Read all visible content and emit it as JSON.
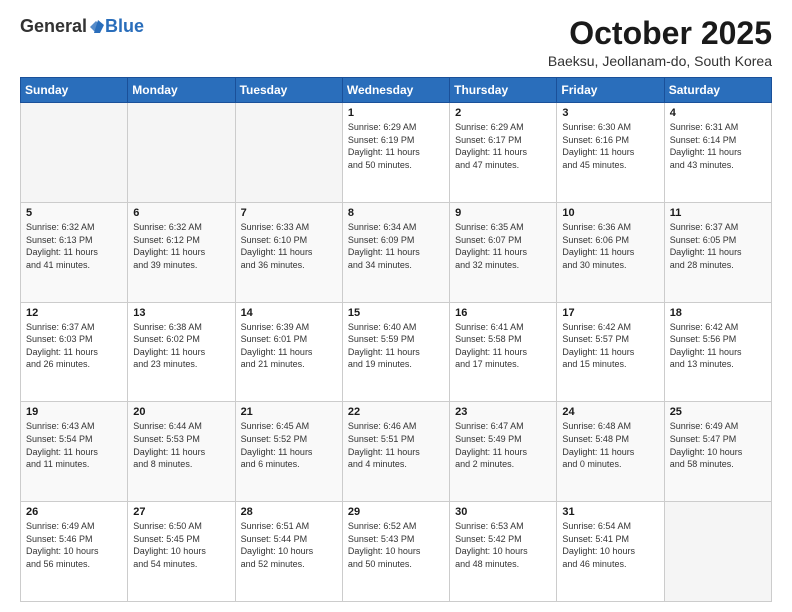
{
  "logo": {
    "general": "General",
    "blue": "Blue"
  },
  "header": {
    "month": "October 2025",
    "location": "Baeksu, Jeollanam-do, South Korea"
  },
  "days_of_week": [
    "Sunday",
    "Monday",
    "Tuesday",
    "Wednesday",
    "Thursday",
    "Friday",
    "Saturday"
  ],
  "weeks": [
    [
      {
        "day": "",
        "info": ""
      },
      {
        "day": "",
        "info": ""
      },
      {
        "day": "",
        "info": ""
      },
      {
        "day": "1",
        "info": "Sunrise: 6:29 AM\nSunset: 6:19 PM\nDaylight: 11 hours\nand 50 minutes."
      },
      {
        "day": "2",
        "info": "Sunrise: 6:29 AM\nSunset: 6:17 PM\nDaylight: 11 hours\nand 47 minutes."
      },
      {
        "day": "3",
        "info": "Sunrise: 6:30 AM\nSunset: 6:16 PM\nDaylight: 11 hours\nand 45 minutes."
      },
      {
        "day": "4",
        "info": "Sunrise: 6:31 AM\nSunset: 6:14 PM\nDaylight: 11 hours\nand 43 minutes."
      }
    ],
    [
      {
        "day": "5",
        "info": "Sunrise: 6:32 AM\nSunset: 6:13 PM\nDaylight: 11 hours\nand 41 minutes."
      },
      {
        "day": "6",
        "info": "Sunrise: 6:32 AM\nSunset: 6:12 PM\nDaylight: 11 hours\nand 39 minutes."
      },
      {
        "day": "7",
        "info": "Sunrise: 6:33 AM\nSunset: 6:10 PM\nDaylight: 11 hours\nand 36 minutes."
      },
      {
        "day": "8",
        "info": "Sunrise: 6:34 AM\nSunset: 6:09 PM\nDaylight: 11 hours\nand 34 minutes."
      },
      {
        "day": "9",
        "info": "Sunrise: 6:35 AM\nSunset: 6:07 PM\nDaylight: 11 hours\nand 32 minutes."
      },
      {
        "day": "10",
        "info": "Sunrise: 6:36 AM\nSunset: 6:06 PM\nDaylight: 11 hours\nand 30 minutes."
      },
      {
        "day": "11",
        "info": "Sunrise: 6:37 AM\nSunset: 6:05 PM\nDaylight: 11 hours\nand 28 minutes."
      }
    ],
    [
      {
        "day": "12",
        "info": "Sunrise: 6:37 AM\nSunset: 6:03 PM\nDaylight: 11 hours\nand 26 minutes."
      },
      {
        "day": "13",
        "info": "Sunrise: 6:38 AM\nSunset: 6:02 PM\nDaylight: 11 hours\nand 23 minutes."
      },
      {
        "day": "14",
        "info": "Sunrise: 6:39 AM\nSunset: 6:01 PM\nDaylight: 11 hours\nand 21 minutes."
      },
      {
        "day": "15",
        "info": "Sunrise: 6:40 AM\nSunset: 5:59 PM\nDaylight: 11 hours\nand 19 minutes."
      },
      {
        "day": "16",
        "info": "Sunrise: 6:41 AM\nSunset: 5:58 PM\nDaylight: 11 hours\nand 17 minutes."
      },
      {
        "day": "17",
        "info": "Sunrise: 6:42 AM\nSunset: 5:57 PM\nDaylight: 11 hours\nand 15 minutes."
      },
      {
        "day": "18",
        "info": "Sunrise: 6:42 AM\nSunset: 5:56 PM\nDaylight: 11 hours\nand 13 minutes."
      }
    ],
    [
      {
        "day": "19",
        "info": "Sunrise: 6:43 AM\nSunset: 5:54 PM\nDaylight: 11 hours\nand 11 minutes."
      },
      {
        "day": "20",
        "info": "Sunrise: 6:44 AM\nSunset: 5:53 PM\nDaylight: 11 hours\nand 8 minutes."
      },
      {
        "day": "21",
        "info": "Sunrise: 6:45 AM\nSunset: 5:52 PM\nDaylight: 11 hours\nand 6 minutes."
      },
      {
        "day": "22",
        "info": "Sunrise: 6:46 AM\nSunset: 5:51 PM\nDaylight: 11 hours\nand 4 minutes."
      },
      {
        "day": "23",
        "info": "Sunrise: 6:47 AM\nSunset: 5:49 PM\nDaylight: 11 hours\nand 2 minutes."
      },
      {
        "day": "24",
        "info": "Sunrise: 6:48 AM\nSunset: 5:48 PM\nDaylight: 11 hours\nand 0 minutes."
      },
      {
        "day": "25",
        "info": "Sunrise: 6:49 AM\nSunset: 5:47 PM\nDaylight: 10 hours\nand 58 minutes."
      }
    ],
    [
      {
        "day": "26",
        "info": "Sunrise: 6:49 AM\nSunset: 5:46 PM\nDaylight: 10 hours\nand 56 minutes."
      },
      {
        "day": "27",
        "info": "Sunrise: 6:50 AM\nSunset: 5:45 PM\nDaylight: 10 hours\nand 54 minutes."
      },
      {
        "day": "28",
        "info": "Sunrise: 6:51 AM\nSunset: 5:44 PM\nDaylight: 10 hours\nand 52 minutes."
      },
      {
        "day": "29",
        "info": "Sunrise: 6:52 AM\nSunset: 5:43 PM\nDaylight: 10 hours\nand 50 minutes."
      },
      {
        "day": "30",
        "info": "Sunrise: 6:53 AM\nSunset: 5:42 PM\nDaylight: 10 hours\nand 48 minutes."
      },
      {
        "day": "31",
        "info": "Sunrise: 6:54 AM\nSunset: 5:41 PM\nDaylight: 10 hours\nand 46 minutes."
      },
      {
        "day": "",
        "info": ""
      }
    ]
  ]
}
